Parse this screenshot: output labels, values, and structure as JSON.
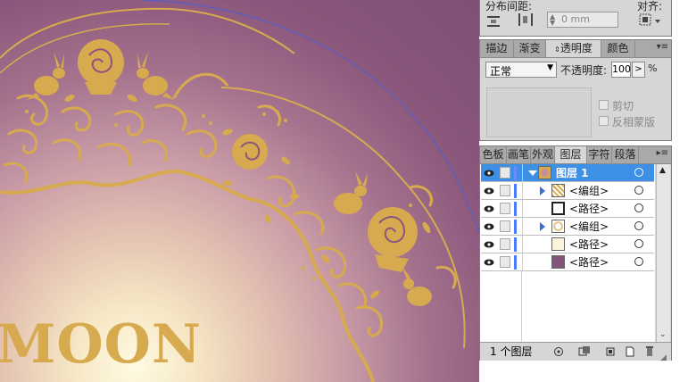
{
  "canvas": {
    "text": "MOON",
    "colors": {
      "gold": "#d8aa4f",
      "purple": "#84557b",
      "guide": "#4a5fd8"
    }
  },
  "align_panel": {
    "distribute_spacing_label": "分布间距:",
    "align_to_label": "对齐:",
    "spacing_value": "0 mm"
  },
  "transparency_panel": {
    "tabs": [
      "描边",
      "渐变",
      "透明度",
      "颜色"
    ],
    "blend_mode": "正常",
    "opacity_label": "不透明度:",
    "opacity_value": "100",
    "opacity_unit": "%",
    "clip_label": "剪切",
    "invert_mask_label": "反相蒙版"
  },
  "layers_panel": {
    "tabs": [
      "色板",
      "画笔",
      "外观",
      "图层",
      "字符",
      "段落"
    ],
    "rows": [
      {
        "name": "图层 1",
        "selected": true,
        "thumb": "layer"
      },
      {
        "name": "<编组>",
        "selected": false,
        "thumb": "group1"
      },
      {
        "name": "<路径>",
        "selected": false,
        "thumb": "white"
      },
      {
        "name": "<编组>",
        "selected": false,
        "thumb": "group2"
      },
      {
        "name": "<路径>",
        "selected": false,
        "thumb": "cream"
      },
      {
        "name": "<路径>",
        "selected": false,
        "thumb": "purple"
      }
    ],
    "footer_count": "1 个图层"
  }
}
